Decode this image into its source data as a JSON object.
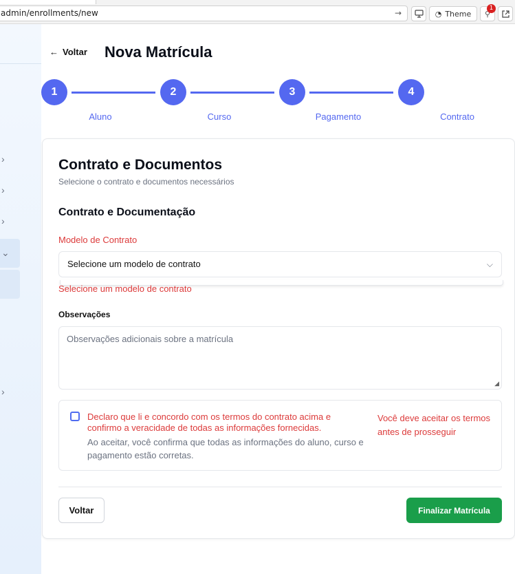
{
  "browser": {
    "url": "admin/enrollments/new",
    "theme_label": "Theme",
    "notification_count": "1"
  },
  "header": {
    "back_label": "Voltar",
    "title": "Nova Matrícula"
  },
  "steps": [
    {
      "number": "1",
      "label": "Aluno"
    },
    {
      "number": "2",
      "label": "Curso"
    },
    {
      "number": "3",
      "label": "Pagamento"
    },
    {
      "number": "4",
      "label": "Contrato"
    }
  ],
  "card": {
    "title": "Contrato e Documentos",
    "subtitle": "Selecione o contrato e documentos necessários",
    "section_title": "Contrato e Documentação",
    "contract_model_label": "Modelo de Contrato",
    "contract_model_value": "Selecione um modelo de contrato",
    "contract_model_error": "Selecione um modelo de contrato",
    "notes_label": "Observações",
    "notes_placeholder": "Observações adicionais sobre a matrícula",
    "terms": {
      "checked": false,
      "main_text": "Declaro que li e concordo com os termos do contrato acima e confirmo a veracidade de todas as informações fornecidas.",
      "sub_text": "Ao aceitar, você confirma que todas as informações do aluno, curso e pagamento estão corretas.",
      "error": "Você deve aceitar os termos antes de prosseguir"
    },
    "back_button": "Voltar",
    "finish_button": "Finalizar Matrícula"
  },
  "colors": {
    "accent": "#5468f0",
    "error": "#dc3a3a",
    "success": "#1a9e4a"
  }
}
